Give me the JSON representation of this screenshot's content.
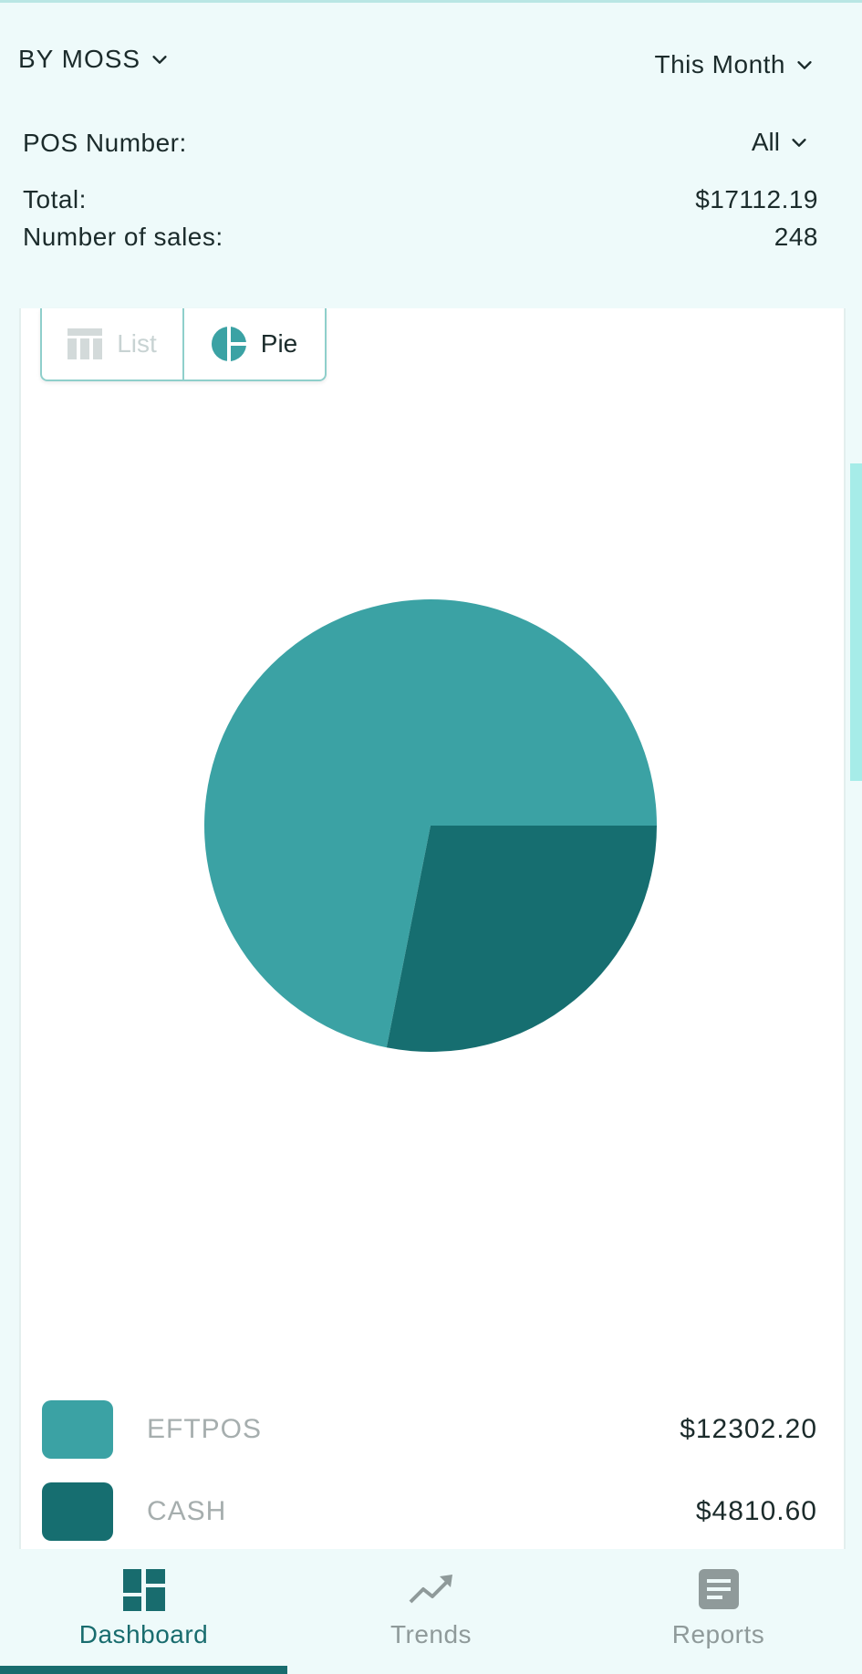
{
  "header": {
    "store": "BY MOSS",
    "period": "This Month",
    "pos_label": "POS Number:",
    "pos_value": "All",
    "total_label": "Total:",
    "total_value": "$17112.19",
    "sales_label": "Number of sales:",
    "sales_value": "248"
  },
  "view_toggle": {
    "list_label": "List",
    "pie_label": "Pie",
    "selected": "Pie"
  },
  "colors": {
    "eftpos": "#3ba2a4",
    "cash": "#166e70",
    "accent": "#186c6e",
    "background": "#eefafa"
  },
  "chart_data": {
    "type": "pie",
    "categories": [
      "EFTPOS",
      "CASH"
    ],
    "values": [
      12302.2,
      4810.6
    ]
  },
  "legend": [
    {
      "label": "EFTPOS",
      "value": "$12302.20"
    },
    {
      "label": "CASH",
      "value": "$4810.60"
    }
  ],
  "nav": {
    "items": [
      {
        "label": "Dashboard",
        "icon": "dashboard-icon",
        "active": true
      },
      {
        "label": "Trends",
        "icon": "trending-up-icon",
        "active": false
      },
      {
        "label": "Reports",
        "icon": "report-icon",
        "active": false
      }
    ]
  }
}
